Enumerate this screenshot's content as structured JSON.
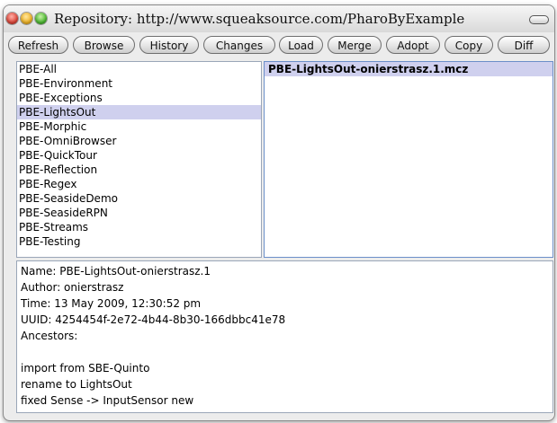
{
  "window": {
    "title": "Repository: http://www.squeaksource.com/PharoByExample"
  },
  "toolbar": {
    "buttons": [
      "Refresh",
      "Browse",
      "History",
      "Changes",
      "Load",
      "Merge",
      "Adopt",
      "Copy",
      "Diff"
    ]
  },
  "packages": {
    "items": [
      "PBE-All",
      "PBE-Environment",
      "PBE-Exceptions",
      "PBE-LightsOut",
      "PBE-Morphic",
      "PBE-OmniBrowser",
      "PBE-QuickTour",
      "PBE-Reflection",
      "PBE-Regex",
      "PBE-SeasideDemo",
      "PBE-SeasideRPN",
      "PBE-Streams",
      "PBE-Testing"
    ],
    "selected": "PBE-LightsOut"
  },
  "versions": {
    "items": [
      "PBE-LightsOut-onierstrasz.1.mcz"
    ],
    "selected": "PBE-LightsOut-onierstrasz.1.mcz"
  },
  "info": {
    "lines": [
      "Name: PBE-LightsOut-onierstrasz.1",
      "Author: onierstrasz",
      "Time: 13 May 2009, 12:30:52 pm",
      "UUID: 4254454f-2e72-4b44-8b30-166dbbc41e78",
      "Ancestors:",
      "",
      "import from SBE-Quinto",
      "rename to LightsOut",
      "fixed Sense -> InputSensor new"
    ]
  },
  "colors": {
    "selection": "#cfd0ee",
    "window_bg": "#ececec"
  }
}
